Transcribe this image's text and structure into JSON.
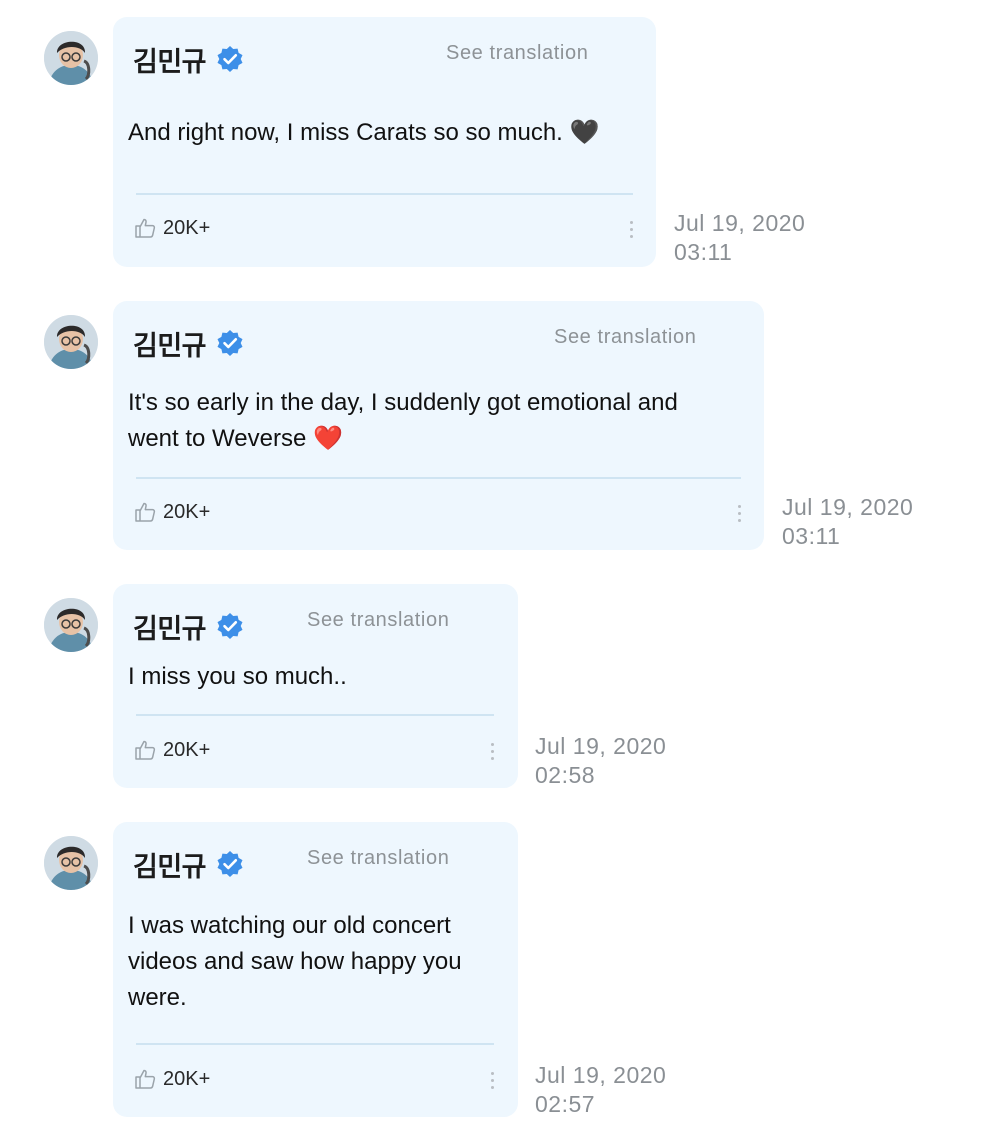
{
  "posts": [
    {
      "author": "김민규",
      "see_translation": "See translation",
      "content": "And right now, I miss Carats so so much. 🖤",
      "likes": "20K+",
      "date": "Jul 19, 2020",
      "time": "03:11"
    },
    {
      "author": "김민규",
      "see_translation": "See translation",
      "content": "It's so early in the day, I suddenly got emotional and\nwent to Weverse ❤️",
      "likes": "20K+",
      "date": "Jul 19, 2020",
      "time": "03:11"
    },
    {
      "author": "김민규",
      "see_translation": "See translation",
      "content": "I miss you so much..",
      "likes": "20K+",
      "date": "Jul 19, 2020",
      "time": "02:58"
    },
    {
      "author": "김민규",
      "see_translation": "See translation",
      "content": "I was watching our old concert\nvideos and saw how happy you\nwere.",
      "likes": "20K+",
      "date": "Jul 19, 2020",
      "time": "02:57"
    }
  ],
  "icons": {
    "verified": "verified-badge-icon",
    "like": "thumbs-up-icon",
    "more": "vertical-ellipsis-icon"
  },
  "colors": {
    "bubble": "#eef7fe",
    "verified": "#3d8fe8",
    "divider": "#cfe4f2",
    "muted_text": "#8a8f94"
  }
}
